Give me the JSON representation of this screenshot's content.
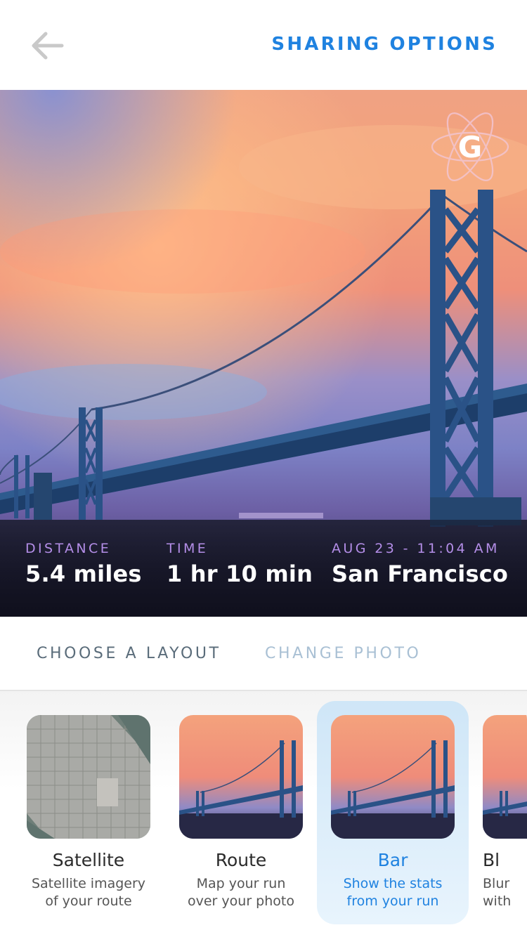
{
  "header": {
    "back_icon": "arrow-left-icon",
    "share_label": "SHARING OPTIONS",
    "accent_color": "#1f82e0"
  },
  "hero": {
    "logo_letter": "G",
    "stats": [
      {
        "label": "DISTANCE",
        "value": "5.4 miles"
      },
      {
        "label": "TIME",
        "value": "1 hr 10 min"
      },
      {
        "label": "AUG 23 - 11:04 AM",
        "value": "San Francisco"
      }
    ]
  },
  "tabs": {
    "layout_label": "CHOOSE A LAYOUT",
    "photo_label": "CHANGE PHOTO",
    "active": "CHOOSE A LAYOUT"
  },
  "layouts": [
    {
      "title": "Satellite",
      "desc1": "Satellite imagery",
      "desc2": "of your route",
      "selected": false
    },
    {
      "title": "Route",
      "desc1": "Map your run",
      "desc2": "over your photo",
      "selected": false
    },
    {
      "title": "Bar",
      "desc1": "Show the stats",
      "desc2": "from your run",
      "selected": true
    },
    {
      "title": "Bl",
      "desc1": "Blur",
      "desc2": "with",
      "selected": false
    }
  ]
}
